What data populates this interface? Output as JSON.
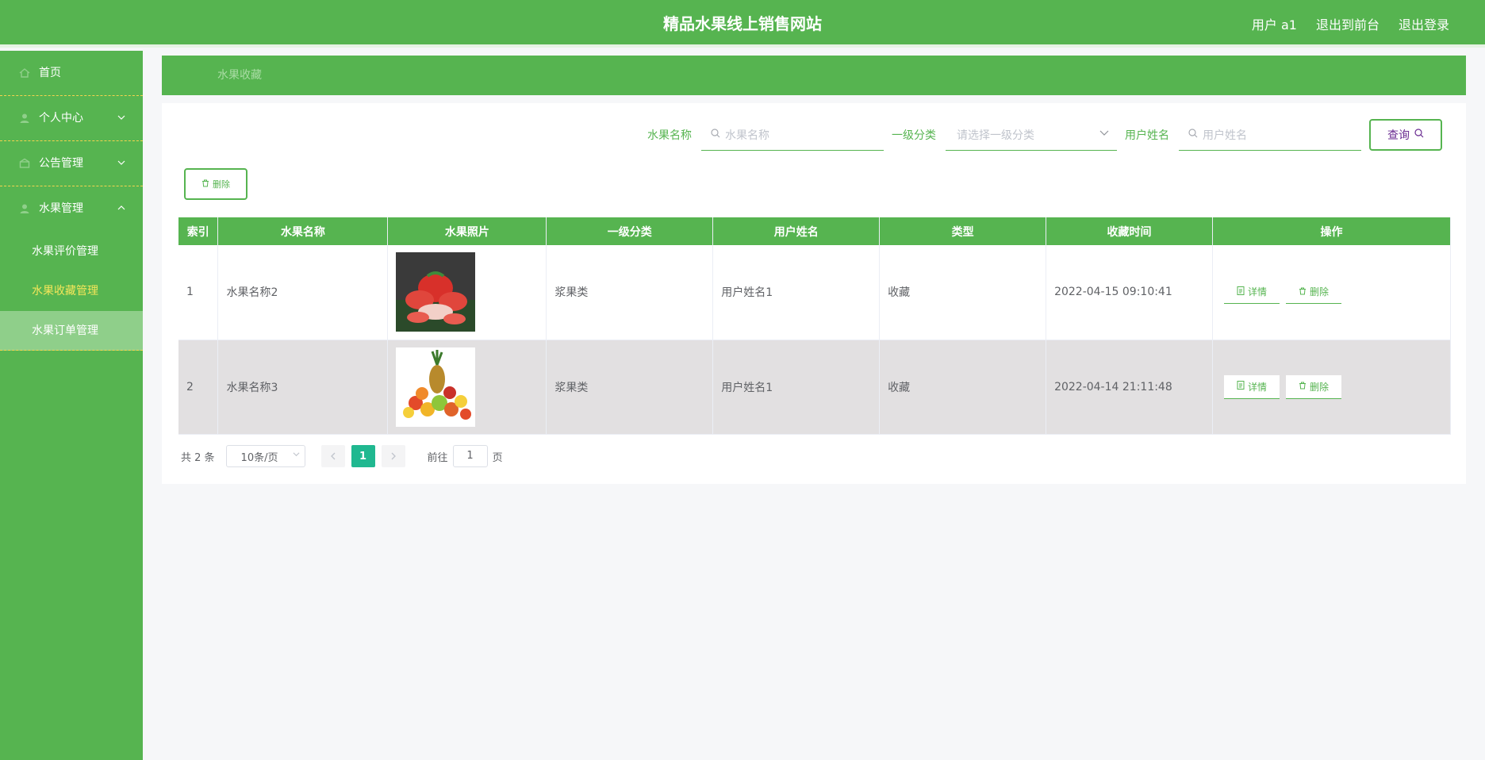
{
  "header": {
    "title": "精品水果线上销售网站",
    "user": "用户 a1",
    "to_front": "退出到前台",
    "logout": "退出登录"
  },
  "sidebar": {
    "items": [
      {
        "label": "首页"
      },
      {
        "label": "个人中心"
      },
      {
        "label": "公告管理"
      },
      {
        "label": "水果管理"
      }
    ],
    "sub_items": [
      {
        "label": "水果评价管理"
      },
      {
        "label": "水果收藏管理"
      },
      {
        "label": "水果订单管理"
      }
    ]
  },
  "breadcrumb": "水果收藏",
  "search": {
    "name_label": "水果名称",
    "name_placeholder": "水果名称",
    "category_label": "一级分类",
    "category_placeholder": "请选择一级分类",
    "user_label": "用户姓名",
    "user_placeholder": "用户姓名",
    "query_button": "查询"
  },
  "delete_button": "删除",
  "table": {
    "headers": [
      "索引",
      "水果名称",
      "水果照片",
      "一级分类",
      "用户姓名",
      "类型",
      "收藏时间",
      "操作"
    ],
    "rows": [
      {
        "index": "1",
        "name": "水果名称2",
        "category": "浆果类",
        "user": "用户姓名1",
        "type": "收藏",
        "time": "2022-04-15 09:10:41",
        "photo": "strawberries"
      },
      {
        "index": "2",
        "name": "水果名称3",
        "category": "浆果类",
        "user": "用户姓名1",
        "type": "收藏",
        "time": "2022-04-14 21:11:48",
        "photo": "mixed-fruit-pineapple"
      }
    ],
    "detail_button": "详情",
    "delete_button": "删除"
  },
  "pagination": {
    "total": "共 2 条",
    "page_size": "10条/页",
    "current_page": "1",
    "goto_label": "前往",
    "goto_value": "1",
    "page_suffix": "页"
  },
  "colors": {
    "primary": "#56b450",
    "active_page": "#20b890",
    "active_menu_text": "#f4e65a"
  }
}
